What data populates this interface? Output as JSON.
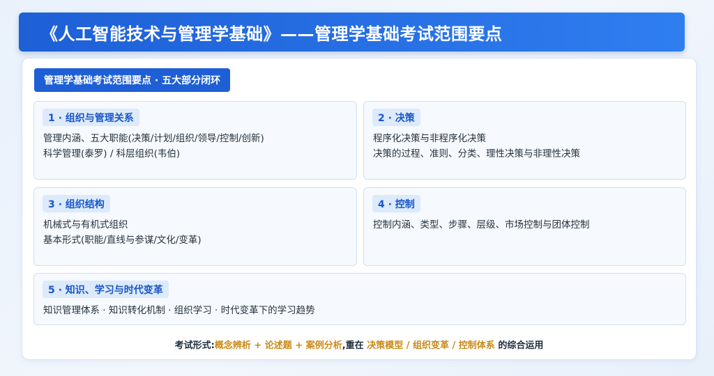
{
  "title": "《人工智能技术与管理学基础》——管理学基础考试范围要点",
  "tag": "管理学基础考试范围要点 · 五大部分闭环",
  "sections": [
    {
      "heading": "1 · 组织与管理关系",
      "lines": [
        "管理内涵、五大职能(决策/计划/组织/领导/控制/创新)",
        "科学管理(泰罗) / 科层组织(韦伯)"
      ]
    },
    {
      "heading": "2 · 决策",
      "lines": [
        "程序化决策与非程序化决策",
        "决策的过程、准则、分类、理性决策与非理性决策"
      ]
    },
    {
      "heading": "3 · 组织结构",
      "lines": [
        "机械式与有机式组织",
        "基本形式(职能/直线与参谋/文化/变革)"
      ]
    },
    {
      "heading": "4 · 控制",
      "lines": [
        "控制内涵、类型、步骤、层级、市场控制与团体控制"
      ]
    },
    {
      "heading": "5 · 知识、学习与时代变革",
      "lines": [
        "知识管理体系 · 知识转化机制 · 组织学习 · 时代变革下的学习趋势"
      ]
    }
  ],
  "footer": {
    "label": "考试形式:",
    "forms": "概念辨析 + 论述题 + 案例分析",
    "focus_prefix": ",重在 ",
    "focus": "决策模型 / 组织变革 / 控制体系",
    "suffix": " 的综合运用"
  },
  "colors": {
    "primary": "#1e5fd6",
    "heading_text": "#1a56c8",
    "heading_bg": "#dceafb",
    "highlight": "#c98a18"
  }
}
